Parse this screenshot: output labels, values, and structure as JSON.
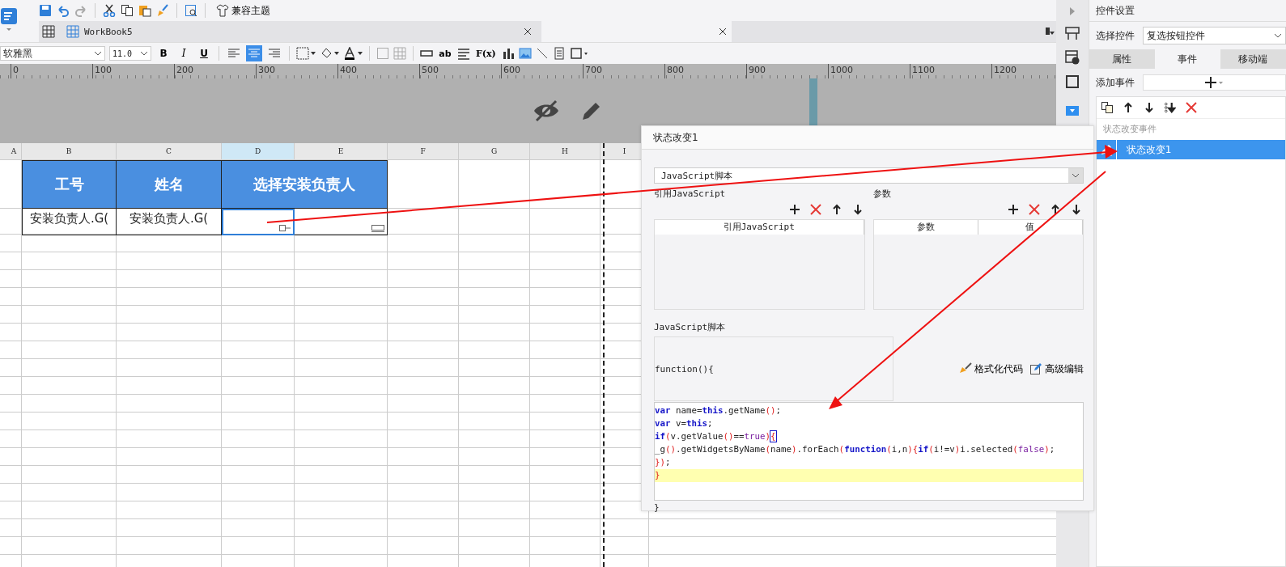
{
  "toolbar": {
    "theme_button": "兼容主题"
  },
  "tabs": [
    {
      "label": "WorkBook5",
      "selected": true
    }
  ],
  "format_bar": {
    "font": "软雅黑",
    "size": "11.0",
    "bold": "B",
    "italic": "I",
    "underline": "U",
    "text_button": "ab",
    "formula_button": "F(x)",
    "align": [
      {
        "selected": false
      },
      {
        "selected": true
      },
      {
        "selected": false
      }
    ]
  },
  "ruler": {
    "ticks": [
      "0",
      "100",
      "200",
      "300",
      "400",
      "500",
      "600",
      "700",
      "800",
      "900",
      "1000",
      "1100",
      "1200"
    ]
  },
  "sheet": {
    "columns": [
      {
        "label": "A",
        "selected": false
      },
      {
        "label": "B",
        "selected": false
      },
      {
        "label": "C",
        "selected": false
      },
      {
        "label": "D",
        "selected": true
      },
      {
        "label": "E",
        "selected": false
      },
      {
        "label": "F",
        "selected": false
      },
      {
        "label": "G",
        "selected": false
      },
      {
        "label": "H",
        "selected": false
      },
      {
        "label": "I",
        "selected": false
      }
    ],
    "header_cells": [
      "工号",
      "姓名",
      "选择安装负责人"
    ],
    "row_cells": [
      "安装负责人.G(",
      "安装负责人.G("
    ]
  },
  "dialog": {
    "title": "状态改变1",
    "type_select": "JavaScript脚本",
    "ref_section": {
      "title": "引用JavaScript",
      "column": "引用JavaScript"
    },
    "param_section": {
      "title": "参数",
      "columns": [
        "参数",
        "值"
      ]
    },
    "script_section": {
      "title": "JavaScript脚本",
      "signature": "function(){",
      "format_button": "格式化代码",
      "advanced_button": "高级编辑",
      "closing": "}",
      "code": [
        {
          "highlighted": false,
          "tokens": [
            {
              "text": "var",
              "kind": "kw"
            },
            {
              "text": " name=",
              "kind": "plain"
            },
            {
              "text": "this",
              "kind": "kw"
            },
            {
              "text": ".getName",
              "kind": "plain"
            },
            {
              "text": "()",
              "kind": "paren"
            },
            {
              "text": ";",
              "kind": "plain"
            }
          ]
        },
        {
          "highlighted": false,
          "tokens": [
            {
              "text": "var",
              "kind": "kw"
            },
            {
              "text": " v=",
              "kind": "plain"
            },
            {
              "text": "this",
              "kind": "kw"
            },
            {
              "text": ";",
              "kind": "plain"
            }
          ]
        },
        {
          "highlighted": false,
          "tokens": [
            {
              "text": "if",
              "kind": "kw"
            },
            {
              "text": "(",
              "kind": "paren"
            },
            {
              "text": "v.getValue",
              "kind": "plain"
            },
            {
              "text": "()",
              "kind": "paren"
            },
            {
              "text": "==",
              "kind": "plain"
            },
            {
              "text": "true",
              "kind": "lit"
            },
            {
              "text": ")",
              "kind": "paren"
            },
            {
              "text": "{",
              "kind": "match"
            }
          ]
        },
        {
          "highlighted": false,
          "tokens": [
            {
              "text": "_g",
              "kind": "plain"
            },
            {
              "text": "()",
              "kind": "paren"
            },
            {
              "text": ".getWidgetsByName",
              "kind": "plain"
            },
            {
              "text": "(",
              "kind": "paren"
            },
            {
              "text": "name",
              "kind": "plain"
            },
            {
              "text": ")",
              "kind": "paren"
            },
            {
              "text": ".forEach",
              "kind": "plain"
            },
            {
              "text": "(",
              "kind": "paren"
            },
            {
              "text": "function",
              "kind": "kw"
            },
            {
              "text": "(",
              "kind": "paren"
            },
            {
              "text": "i,n",
              "kind": "plain"
            },
            {
              "text": "){",
              "kind": "paren"
            },
            {
              "text": "if",
              "kind": "kw"
            },
            {
              "text": "(",
              "kind": "paren"
            },
            {
              "text": "i!=v",
              "kind": "plain"
            },
            {
              "text": ")",
              "kind": "paren"
            },
            {
              "text": "i.selected",
              "kind": "plain"
            },
            {
              "text": "(",
              "kind": "paren"
            },
            {
              "text": "false",
              "kind": "lit"
            },
            {
              "text": ")",
              "kind": "paren"
            },
            {
              "text": ";",
              "kind": "plain"
            }
          ]
        },
        {
          "highlighted": false,
          "tokens": [
            {
              "text": "})",
              "kind": "paren"
            },
            {
              "text": ";",
              "kind": "plain"
            }
          ]
        },
        {
          "highlighted": true,
          "tokens": [
            {
              "text": "}",
              "kind": "paren"
            }
          ]
        }
      ]
    }
  },
  "panel": {
    "title": "控件设置",
    "select_label": "选择控件",
    "select_value": "复选按钮控件",
    "tabs": [
      {
        "label": "属性",
        "selected": false
      },
      {
        "label": "事件",
        "selected": true
      },
      {
        "label": "移动端",
        "selected": false
      }
    ],
    "add_label": "添加事件",
    "group": "状态改变事件",
    "events": [
      {
        "label": "状态改变1",
        "selected": true
      }
    ]
  }
}
